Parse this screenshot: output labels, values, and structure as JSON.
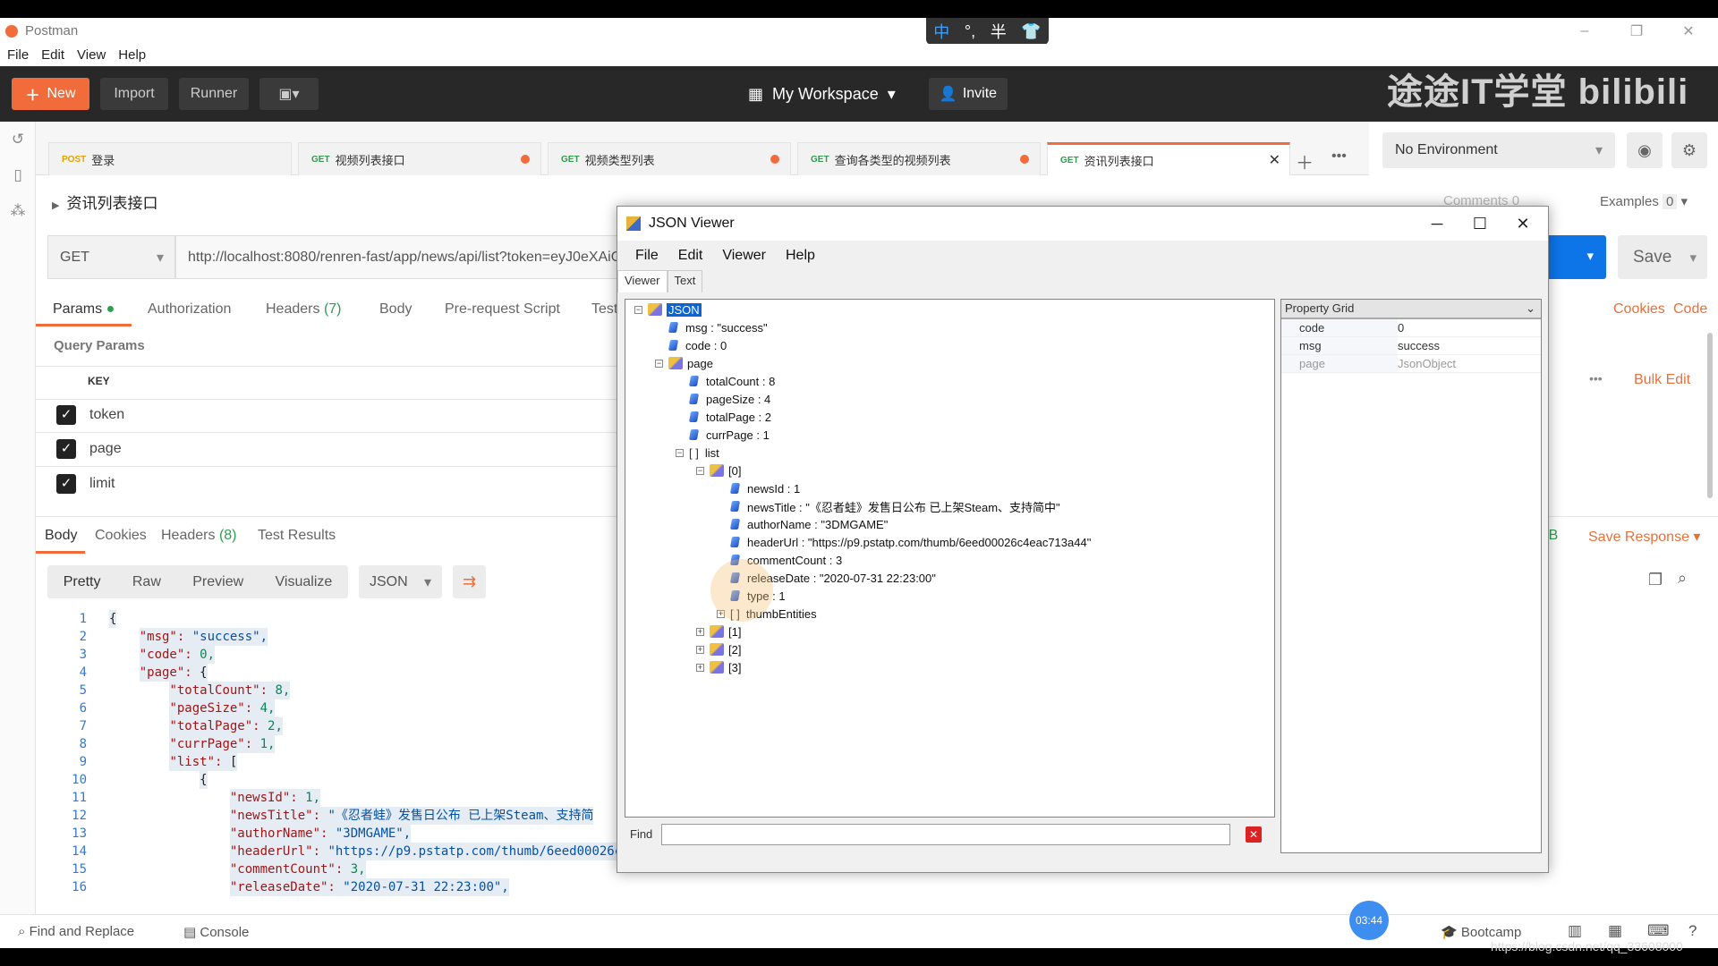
{
  "app": {
    "title": "Postman",
    "menu": [
      "File",
      "Edit",
      "View",
      "Help"
    ]
  },
  "ime": {
    "chars": [
      "中",
      "°,",
      "半",
      "👕"
    ]
  },
  "toolbar": {
    "new": "New",
    "import": "Import",
    "runner": "Runner",
    "workspace": "My Workspace",
    "invite": "Invite",
    "watermark": "途途IT学堂 bilibili"
  },
  "tabs": [
    {
      "method": "POST",
      "name": "登录",
      "unsaved": false
    },
    {
      "method": "GET",
      "name": "视频列表接口",
      "unsaved": true
    },
    {
      "method": "GET",
      "name": "视频类型列表",
      "unsaved": true
    },
    {
      "method": "GET",
      "name": "查询各类型的视频列表",
      "unsaved": true
    },
    {
      "method": "GET",
      "name": "资讯列表接口",
      "unsaved": false,
      "active": true
    }
  ],
  "environment": "No Environment",
  "request": {
    "name": "资讯列表接口",
    "comments": "Comments",
    "comments_count": "0",
    "examples": "Examples",
    "examples_count": "0",
    "method": "GET",
    "url": "http://localhost:8080/renren-fast/app/news/api/list?token=eyJ0eXAiO",
    "save": "Save",
    "cookies": "Cookies",
    "code": "Code"
  },
  "req_tabs": [
    "Params",
    "Authorization",
    "Headers",
    "(7)",
    "Body",
    "Pre-request Script",
    "Test"
  ],
  "params": {
    "title": "Query Params",
    "key_header": "KEY",
    "bulk_edit": "Bulk Edit",
    "rows": [
      "token",
      "page",
      "limit"
    ]
  },
  "response": {
    "tabs": [
      "Body",
      "Cookies",
      "Headers",
      "(8)",
      "Test Results"
    ],
    "save_response": "Save Response",
    "size_suffix": "KB",
    "formats": [
      "Pretty",
      "Raw",
      "Preview",
      "Visualize"
    ],
    "lang": "JSON"
  },
  "code_lines": [
    [
      "1",
      "{",
      "",
      ""
    ],
    [
      "2",
      "    ",
      "\"msg\": ",
      "\"success\","
    ],
    [
      "3",
      "    ",
      "\"code\": ",
      "0,"
    ],
    [
      "4",
      "    ",
      "\"page\": ",
      "{"
    ],
    [
      "5",
      "        ",
      "\"totalCount\": ",
      "8,"
    ],
    [
      "6",
      "        ",
      "\"pageSize\": ",
      "4,"
    ],
    [
      "7",
      "        ",
      "\"totalPage\": ",
      "2,"
    ],
    [
      "8",
      "        ",
      "\"currPage\": ",
      "1,"
    ],
    [
      "9",
      "        ",
      "\"list\": ",
      "["
    ],
    [
      "10",
      "            ",
      "",
      "{"
    ],
    [
      "11",
      "                ",
      "\"newsId\": ",
      "1,"
    ],
    [
      "12",
      "                ",
      "\"newsTitle\": ",
      "\"《忍者蛙》发售日公布 已上架Steam、支持简"
    ],
    [
      "13",
      "                ",
      "\"authorName\": ",
      "\"3DMGAME\","
    ],
    [
      "14",
      "                ",
      "\"headerUrl\": ",
      "\"https://p9.pstatp.com/thumb/6eed00026c4"
    ],
    [
      "15",
      "                ",
      "\"commentCount\": ",
      "3,"
    ],
    [
      "16",
      "                ",
      "\"releaseDate\": ",
      "\"2020-07-31 22:23:00\","
    ]
  ],
  "bottom": {
    "find": "Find and Replace",
    "console": "Console",
    "bootcamp": "Bootcamp",
    "timer": "03:44",
    "csdn": "https://blog.csdn.net/qq_33608000"
  },
  "json_viewer": {
    "title": "JSON Viewer",
    "menu": [
      "File",
      "Edit",
      "Viewer",
      "Help"
    ],
    "tabs": [
      "Viewer",
      "Text"
    ],
    "tree": [
      {
        "level": 0,
        "type": "obj",
        "text": "JSON",
        "exp": "−",
        "selected": true
      },
      {
        "level": 1,
        "type": "val",
        "text": "msg : \"success\""
      },
      {
        "level": 1,
        "type": "val",
        "text": "code : 0"
      },
      {
        "level": 1,
        "type": "obj",
        "text": "page",
        "exp": "−"
      },
      {
        "level": 2,
        "type": "val",
        "text": "totalCount : 8"
      },
      {
        "level": 2,
        "type": "val",
        "text": "pageSize : 4"
      },
      {
        "level": 2,
        "type": "val",
        "text": "totalPage : 2"
      },
      {
        "level": 2,
        "type": "val",
        "text": "currPage : 1"
      },
      {
        "level": 2,
        "type": "arr",
        "text": "list",
        "exp": "−"
      },
      {
        "level": 3,
        "type": "obj",
        "text": "[0]",
        "exp": "−"
      },
      {
        "level": 4,
        "type": "val",
        "text": "newsId : 1"
      },
      {
        "level": 4,
        "type": "val",
        "text": "newsTitle : \"《忍者蛙》发售日公布 已上架Steam、支持简中\""
      },
      {
        "level": 4,
        "type": "val",
        "text": "authorName : \"3DMGAME\""
      },
      {
        "level": 4,
        "type": "val",
        "text": "headerUrl : \"https://p9.pstatp.com/thumb/6eed00026c4eac713a44\""
      },
      {
        "level": 4,
        "type": "val",
        "text": "commentCount : 3"
      },
      {
        "level": 4,
        "type": "val",
        "text": "releaseDate : \"2020-07-31 22:23:00\""
      },
      {
        "level": 4,
        "type": "val",
        "text": "type : 1"
      },
      {
        "level": 4,
        "type": "arr",
        "text": "thumbEntities",
        "exp": "+"
      },
      {
        "level": 3,
        "type": "obj",
        "text": "[1]",
        "exp": "+"
      },
      {
        "level": 3,
        "type": "obj",
        "text": "[2]",
        "exp": "+"
      },
      {
        "level": 3,
        "type": "obj",
        "text": "[3]",
        "exp": "+"
      }
    ],
    "property_grid": {
      "title": "Property Grid",
      "rows": [
        [
          "code",
          "0"
        ],
        [
          "msg",
          "success"
        ],
        [
          "page",
          "JsonObject"
        ]
      ]
    },
    "find_label": "Find"
  },
  "colors": {
    "accent": "#f26b3a",
    "send": "#0d75e8",
    "selection": "#0a64d8"
  }
}
